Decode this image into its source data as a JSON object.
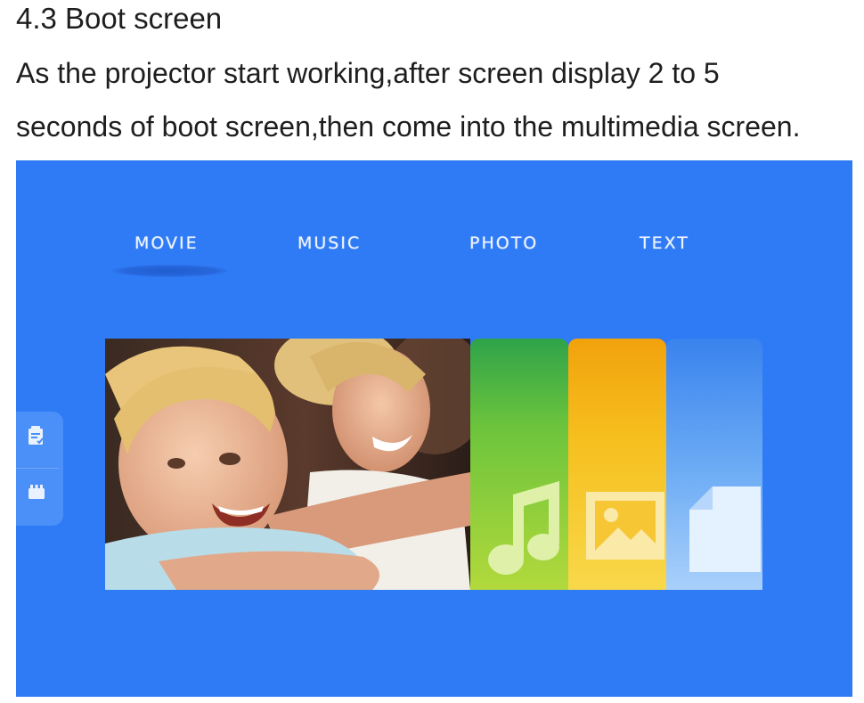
{
  "document": {
    "heading": "4.3 Boot screen",
    "paragraph_line1": "As the projector start working,after screen display 2 to 5",
    "paragraph_line2": "seconds of boot screen,then come into the multimedia screen."
  },
  "screen": {
    "background": "#2f7bf6",
    "tabs": [
      {
        "label": "MOVIE",
        "selected": true
      },
      {
        "label": "MUSIC",
        "selected": false
      },
      {
        "label": "PHOTO",
        "selected": false
      },
      {
        "label": "TEXT",
        "selected": false
      }
    ],
    "side_panel": {
      "icons": [
        "notes-icon",
        "storage-icon"
      ]
    },
    "carousel": {
      "cards": [
        {
          "kind": "movie-photo"
        },
        {
          "kind": "music",
          "icon": "music-note-icon",
          "color": "#6cc43c"
        },
        {
          "kind": "photo",
          "icon": "picture-icon",
          "color": "#f6bf1e"
        },
        {
          "kind": "text",
          "icon": "document-icon",
          "color": "#6aaaf4"
        }
      ]
    }
  }
}
